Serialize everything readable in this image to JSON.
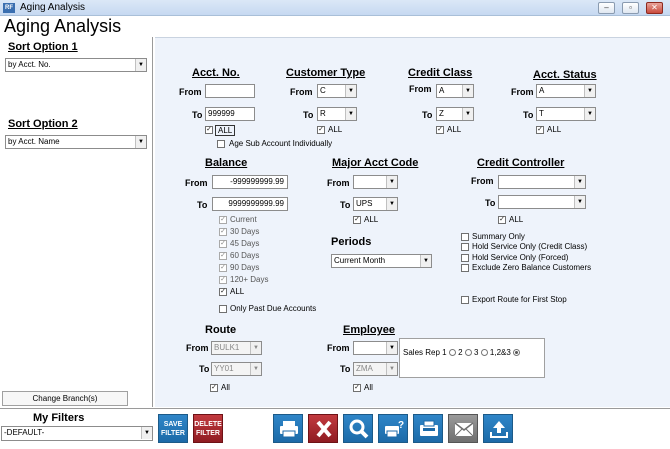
{
  "window": {
    "title": "Aging Analysis",
    "app_icon_text": "RF"
  },
  "page_title": "Aging Analysis",
  "sort1": {
    "title": "Sort Option 1",
    "value": "by Acct. No."
  },
  "sort2": {
    "title": "Sort Option 2",
    "value": "by Acct. Name"
  },
  "change_branch_label": "Change Branch(s)",
  "filters": {
    "title": "My Filters",
    "value": "-DEFAULT-"
  },
  "acct_no": {
    "title": "Acct. No.",
    "from_label": "From",
    "from": "",
    "to_label": "To",
    "to": "999999",
    "all_label": "ALL",
    "age_sub_label": "Age Sub Account Individually"
  },
  "customer_type": {
    "title": "Customer Type",
    "from_label": "From",
    "from": "C",
    "to_label": "To",
    "to": "R",
    "all_label": "ALL"
  },
  "credit_class": {
    "title": "Credit Class",
    "from_label": "From",
    "from": "A",
    "to_label": "To",
    "to": "Z",
    "all_label": "ALL"
  },
  "acct_status": {
    "title": "Acct. Status",
    "from_label": "From",
    "from": "A",
    "to_label": "To",
    "to": "T",
    "all_label": "ALL"
  },
  "balance": {
    "title": "Balance",
    "from_label": "From",
    "from": "-999999999.99",
    "to_label": "To",
    "to": "9999999999.99",
    "days": [
      "Current",
      "30 Days",
      "45 Days",
      "60 Days",
      "90 Days",
      "120+ Days"
    ],
    "all_label": "ALL",
    "past_due_label": "Only Past Due Accounts"
  },
  "major_acct_code": {
    "title": "Major Acct Code",
    "from_label": "From",
    "from": "",
    "to_label": "To",
    "to": "UPS",
    "all_label": "ALL"
  },
  "periods": {
    "title": "Periods",
    "value": "Current Month"
  },
  "credit_controller": {
    "title": "Credit Controller",
    "from_label": "From",
    "from": "",
    "to_label": "To",
    "to": "",
    "all_label": "ALL"
  },
  "options": {
    "summary": "Summary Only",
    "hold_credit": "Hold Service Only (Credit Class)",
    "hold_forced": "Hold Service Only (Forced)",
    "exclude_zero": "Exclude Zero Balance Customers",
    "export_route": "Export Route for First Stop"
  },
  "route": {
    "title": "Route",
    "from_label": "From",
    "from": "BULK1",
    "to_label": "To",
    "to": "YY01",
    "all_label": "All"
  },
  "employee": {
    "title": "Employee",
    "from_label": "From",
    "from": "",
    "to_label": "To",
    "to": "ZMA",
    "all_label": "All",
    "sales_rep_label": "Sales Rep 1",
    "opt2": "2",
    "opt3": "3",
    "opt123": "1,2&3"
  },
  "toolbar": {
    "save_filter_line1": "SAVE",
    "save_filter_line2": "FILTER",
    "delete_filter_line1": "DELETE",
    "delete_filter_line2": "FILTER"
  },
  "colors": {
    "toolbar_blue": "#1c6aa8",
    "delete_red": "#b3252a",
    "panel_bg": "#eef3fb"
  }
}
